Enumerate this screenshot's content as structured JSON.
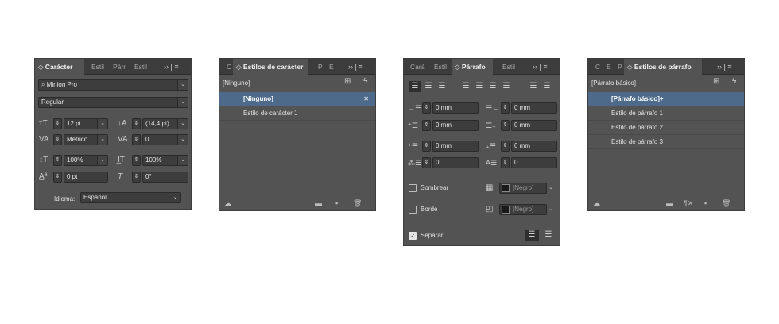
{
  "character_panel": {
    "tabs": [
      "◇ Carácter",
      "Estil",
      "Párr",
      "Estil"
    ],
    "overflow": "›› | ≡",
    "font_family": "Minion Pro",
    "font_style": "Regular",
    "size": "12 pt",
    "leading": "(14,4 pt)",
    "kerning": "Métrico",
    "tracking": "0",
    "vertical_scale": "100%",
    "horizontal_scale": "100%",
    "baseline_shift": "0 pt",
    "skew": "0°",
    "language_label": "Idioma:",
    "language": "Español"
  },
  "char_styles_panel": {
    "tabs": [
      "C",
      "◇ Estilos de carácter",
      "P",
      "E"
    ],
    "overflow": "›› | ≡",
    "current": "[Ninguno]",
    "items": [
      "[Ninguno]",
      "Estilo de carácter 1"
    ]
  },
  "paragraph_panel": {
    "tabs": [
      "Cará",
      "Estil",
      "◇ Párrafo",
      "Estil"
    ],
    "overflow": "›› | ≡",
    "left_indent": "0 mm",
    "right_indent": "0 mm",
    "first_line_indent": "0 mm",
    "last_line_indent": "0 mm",
    "space_before": "0 mm",
    "space_after": "0 mm",
    "dropcap_lines": "0",
    "dropcap_chars": "0",
    "shading_label": "Sombrear",
    "border_label": "Borde",
    "separate_label": "Separar",
    "shading_color": "[Negro]",
    "border_color": "[Negro]"
  },
  "para_styles_panel": {
    "tabs": [
      "C",
      "E",
      "P",
      "◇ Estilos de párrafo"
    ],
    "overflow": "›› | ≡",
    "current": "[Párrafo básico]+",
    "items": [
      "[Párrafo básico]+",
      "Estilo de párrafo 1",
      "Estilo de párrafo 2",
      "Estilo de párrafo 3"
    ]
  },
  "colors": {
    "panel_bg": "#535353",
    "tabbar_bg": "#3c3c3c",
    "selection": "#4e6a8b"
  }
}
